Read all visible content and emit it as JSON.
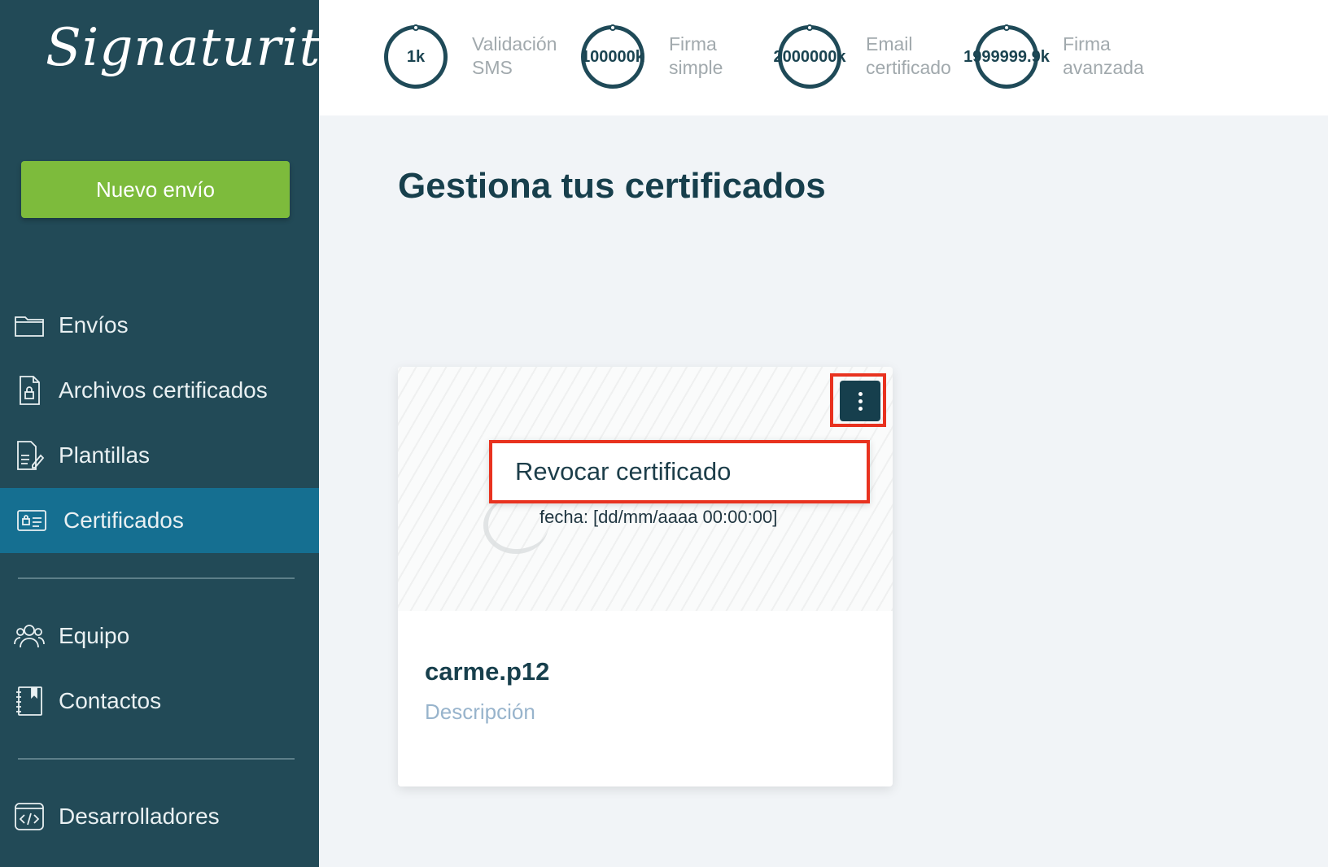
{
  "sidebar": {
    "logo": "Signaturit",
    "new_button": "Nuevo envío",
    "items": [
      {
        "label": "Envíos"
      },
      {
        "label": "Archivos certificados"
      },
      {
        "label": "Plantillas"
      },
      {
        "label": "Certificados"
      },
      {
        "label": "Equipo"
      },
      {
        "label": "Contactos"
      },
      {
        "label": "Desarrolladores"
      }
    ]
  },
  "stats": [
    {
      "value": "1k",
      "label": "Validación SMS"
    },
    {
      "value": "100000k",
      "label": "Firma simple"
    },
    {
      "value": "2000000k",
      "label": "Email certificado"
    },
    {
      "value": "1999999.9k",
      "label": "Firma avanzada"
    }
  ],
  "main": {
    "title": "Gestiona tus certificados",
    "card": {
      "date_text": "fecha: [dd/mm/aaaa 00:00:00]",
      "menu_option": "Revocar certificado",
      "name": "carme.p12",
      "description": "Descripción"
    }
  },
  "colors": {
    "sidebar_bg": "#224a57",
    "active_item": "#156f91",
    "new_button": "#7dbb3c",
    "highlight": "#e8321f"
  }
}
